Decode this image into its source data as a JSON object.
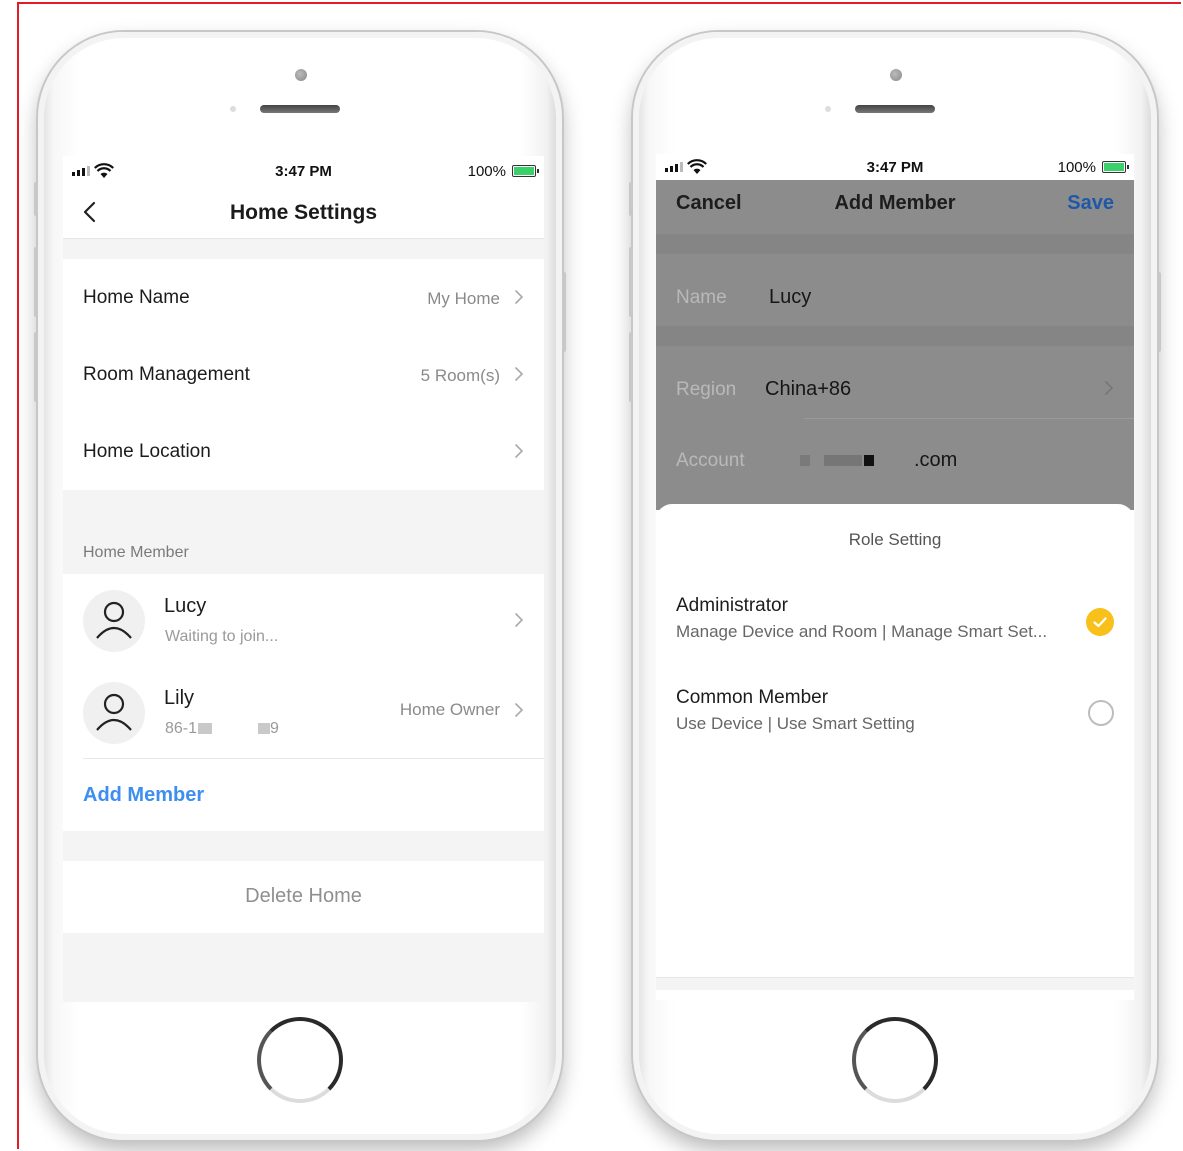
{
  "status": {
    "time": "3:47 PM",
    "battery": "100%"
  },
  "left": {
    "nav_title": "Home Settings",
    "settings": [
      {
        "label": "Home Name",
        "value": "My Home"
      },
      {
        "label": "Room Management",
        "value": "5 Room(s)"
      },
      {
        "label": "Home Location",
        "value": ""
      }
    ],
    "section_header": "Home Member",
    "members": [
      {
        "name": "Lucy",
        "subtitle": "Waiting to join...",
        "role": ""
      },
      {
        "name": "Lily",
        "subtitle_prefix": "86-1",
        "subtitle_suffix": "9",
        "role": "Home Owner"
      }
    ],
    "add_member": "Add Member",
    "delete_home": "Delete Home"
  },
  "right": {
    "cancel": "Cancel",
    "nav_title": "Add Member",
    "save": "Save",
    "name_label": "Name",
    "name_value": "Lucy",
    "region_label": "Region",
    "region_value": "China+86",
    "account_label": "Account",
    "account_value_suffix": ".com",
    "sheet_title": "Role Setting",
    "roles": [
      {
        "name": "Administrator",
        "desc": "Manage Device and Room | Manage Smart Set...",
        "selected": true
      },
      {
        "name": "Common Member",
        "desc": "Use Device | Use Smart Setting",
        "selected": false
      }
    ]
  },
  "colors": {
    "accent_blue": "#3d8ef0",
    "save_blue": "#1f58a8",
    "check_yellow": "#f8c01a",
    "frame_red": "#e11d2a"
  }
}
